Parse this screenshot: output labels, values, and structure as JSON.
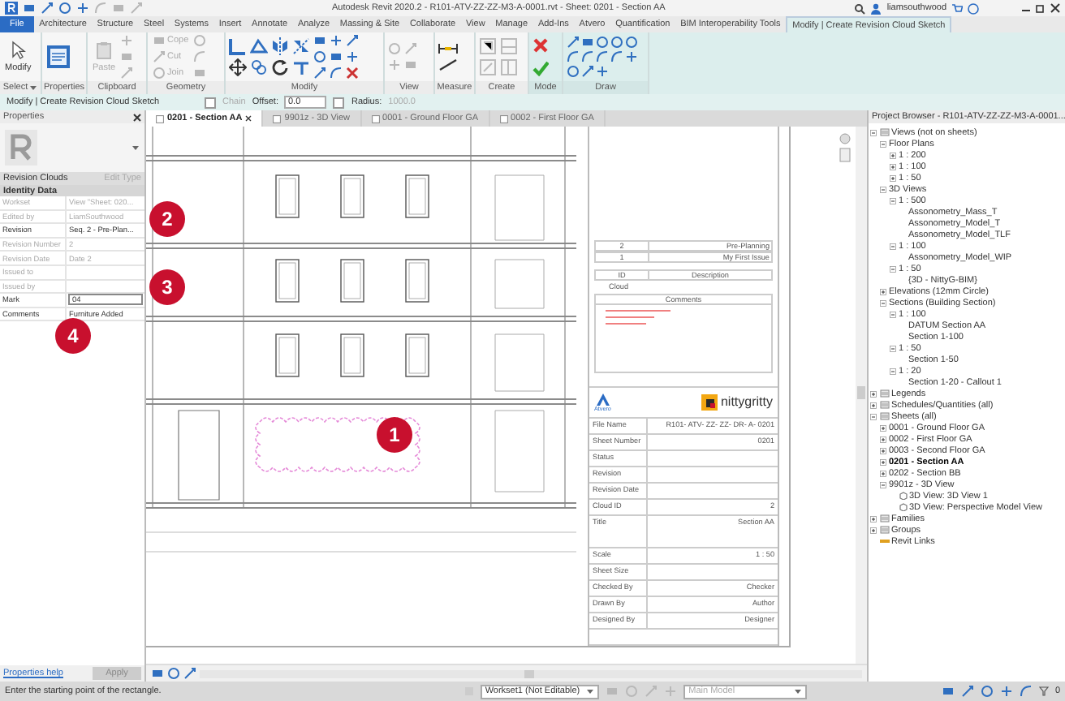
{
  "title_bar": {
    "title": "Autodesk Revit 2020.2 - R101-ATV-ZZ-ZZ-M3-A-0001.rvt - Sheet: 0201 - Section AA",
    "user": "liamsouthwood"
  },
  "ribbon_tabs": [
    {
      "label": "File",
      "kind": "file",
      "selected": false
    },
    {
      "label": "Architecture",
      "kind": "tab",
      "selected": false
    },
    {
      "label": "Structure",
      "kind": "tab",
      "selected": false
    },
    {
      "label": "Steel",
      "kind": "tab",
      "selected": false
    },
    {
      "label": "Systems",
      "kind": "tab",
      "selected": false
    },
    {
      "label": "Insert",
      "kind": "tab",
      "selected": false
    },
    {
      "label": "Annotate",
      "kind": "tab",
      "selected": false
    },
    {
      "label": "Analyze",
      "kind": "tab",
      "selected": false
    },
    {
      "label": "Massing & Site",
      "kind": "tab",
      "selected": false
    },
    {
      "label": "Collaborate",
      "kind": "tab",
      "selected": false
    },
    {
      "label": "View",
      "kind": "tab",
      "selected": false
    },
    {
      "label": "Manage",
      "kind": "tab",
      "selected": false
    },
    {
      "label": "Add-Ins",
      "kind": "tab",
      "selected": false
    },
    {
      "label": "Atvero",
      "kind": "tab",
      "selected": false
    },
    {
      "label": "Quantification",
      "kind": "tab",
      "selected": false
    },
    {
      "label": "BIM Interoperability Tools",
      "kind": "tab",
      "selected": false
    },
    {
      "label": "Modify | Create Revision Cloud Sketch",
      "kind": "contextual",
      "selected": true
    }
  ],
  "ribbon_panels": [
    {
      "label": "Select",
      "dropdown": true,
      "tools": [
        {
          "label": "Modify",
          "disabled": false
        }
      ]
    },
    {
      "label": "Properties",
      "dropdown": false
    },
    {
      "label": "Clipboard",
      "dropdown": false,
      "tools": [
        {
          "label": "Paste",
          "disabled": true
        }
      ]
    },
    {
      "label": "Geometry",
      "dropdown": false,
      "tools": [
        {
          "label": "Cope",
          "disabled": true
        },
        {
          "label": "Cut",
          "disabled": true
        },
        {
          "label": "Join",
          "disabled": true
        }
      ]
    },
    {
      "label": "Modify",
      "dropdown": false
    },
    {
      "label": "View",
      "dropdown": false
    },
    {
      "label": "Measure",
      "dropdown": false
    },
    {
      "label": "Create",
      "dropdown": false
    },
    {
      "label": "Mode",
      "dropdown": false
    },
    {
      "label": "Draw",
      "dropdown": false
    }
  ],
  "options_bar": {
    "context": "Modify | Create Revision Cloud Sketch",
    "chain": {
      "label": "Chain",
      "checked": false,
      "disabled": true
    },
    "offset": {
      "label": "Offset:",
      "value": "0.0"
    },
    "radius": {
      "label": "Radius:",
      "checked": false,
      "value": "1000.0"
    }
  },
  "properties": {
    "title": "Properties",
    "type": "Revision Clouds",
    "edit_type": "Edit Type",
    "group": "Identity Data",
    "rows": [
      {
        "label": "Workset",
        "value": "View \"Sheet: 020...",
        "disabled": true,
        "kind": "text"
      },
      {
        "label": "Edited by",
        "value": "LiamSouthwood",
        "disabled": true,
        "kind": "text"
      },
      {
        "label": "Revision",
        "value": "Seq. 2 - Pre-Plan...",
        "disabled": false,
        "kind": "text"
      },
      {
        "label": "Revision Number",
        "value": "2",
        "disabled": true,
        "kind": "text"
      },
      {
        "label": "Revision Date",
        "value": "Date 2",
        "disabled": true,
        "kind": "text"
      },
      {
        "label": "Issued to",
        "disabled": true,
        "kind": "text"
      },
      {
        "label": "Issued by",
        "disabled": true,
        "kind": "text"
      },
      {
        "label": "Mark",
        "value": "04",
        "disabled": false,
        "kind": "input"
      },
      {
        "label": "Comments",
        "value": "Furniture Added",
        "disabled": false,
        "kind": "text"
      }
    ],
    "help": "Properties help",
    "apply": "Apply"
  },
  "view_tabs": [
    {
      "label": "0201 - Section AA",
      "selected": true
    },
    {
      "label": "9901z - 3D View",
      "selected": false
    },
    {
      "label": "0001 - Ground Floor GA",
      "selected": false
    },
    {
      "label": "0002 - First Floor GA",
      "selected": false
    }
  ],
  "title_block": {
    "revisions": [
      {
        "id": "2",
        "description": "Pre-Planning"
      },
      {
        "id": "1",
        "description": "My First Issue"
      }
    ],
    "revision_header": {
      "id": "ID",
      "description": "Description"
    },
    "cloud_label": "Cloud",
    "comments_label": "Comments",
    "left_logo": "Atvero",
    "right_logo": "nittygritty",
    "fields": [
      {
        "label": "File Name",
        "value": "R101- ATV- ZZ- ZZ- DR- A- 0201",
        "kind": "row"
      },
      {
        "label": "Sheet Number",
        "value": "0201",
        "kind": "row"
      },
      {
        "label": "Status",
        "kind": "row"
      },
      {
        "label": "Revision",
        "kind": "row"
      },
      {
        "label": "Revision Date",
        "kind": "row"
      },
      {
        "label": "Cloud ID",
        "value": "2",
        "kind": "row"
      },
      {
        "label": "Title",
        "value": "Section AA",
        "kind": "tall"
      },
      {
        "label": "Scale",
        "value": "1 : 50",
        "kind": "row"
      },
      {
        "label": "Sheet Size",
        "kind": "row"
      },
      {
        "label": "Checked By",
        "value": "Checker",
        "kind": "row"
      },
      {
        "label": "Drawn By",
        "value": "Author",
        "kind": "row"
      },
      {
        "label": "Designed By",
        "value": "Designer",
        "kind": "row"
      }
    ]
  },
  "callouts": [
    "1",
    "2",
    "3",
    "4"
  ],
  "project_browser": {
    "title": "Project Browser - R101-ATV-ZZ-ZZ-M3-A-0001...",
    "tree": [
      {
        "label": "Views (not on sheets)",
        "kind": "category",
        "expanded": true,
        "children": [
          {
            "label": "Floor Plans",
            "kind": "node",
            "expanded": true,
            "children": [
              {
                "label": "1 : 200",
                "kind": "node",
                "expanded": false
              },
              {
                "label": "1 : 100",
                "kind": "node",
                "expanded": false
              },
              {
                "label": "1 : 50",
                "kind": "node",
                "expanded": false
              }
            ]
          },
          {
            "label": "3D Views",
            "kind": "node",
            "expanded": true,
            "children": [
              {
                "label": "1 : 500",
                "kind": "node",
                "expanded": true,
                "children": [
                  {
                    "label": "Assonometry_Mass_T",
                    "kind": "leaf"
                  },
                  {
                    "label": "Assonometry_Model_T",
                    "kind": "leaf"
                  },
                  {
                    "label": "Assonometry_Model_TLF",
                    "kind": "leaf"
                  }
                ]
              },
              {
                "label": "1 : 100",
                "kind": "node",
                "expanded": true,
                "children": [
                  {
                    "label": "Assonometry_Model_WIP",
                    "kind": "leaf"
                  }
                ]
              },
              {
                "label": "1 : 50",
                "kind": "node",
                "expanded": true,
                "children": [
                  {
                    "label": "{3D - NittyG-BIM}",
                    "kind": "leaf"
                  }
                ]
              }
            ]
          },
          {
            "label": "Elevations (12mm Circle)",
            "kind": "node",
            "expanded": false
          },
          {
            "label": "Sections (Building Section)",
            "kind": "node",
            "expanded": true,
            "children": [
              {
                "label": "1 : 100",
                "kind": "node",
                "expanded": true,
                "children": [
                  {
                    "label": "DATUM Section AA",
                    "kind": "leaf"
                  },
                  {
                    "label": "Section 1-100",
                    "kind": "leaf"
                  }
                ]
              },
              {
                "label": "1 : 50",
                "kind": "node",
                "expanded": true,
                "children": [
                  {
                    "label": "Section 1-50",
                    "kind": "leaf"
                  }
                ]
              },
              {
                "label": "1 : 20",
                "kind": "node",
                "expanded": true,
                "children": [
                  {
                    "label": "Section 1-20 - Callout 1",
                    "kind": "leaf"
                  }
                ]
              }
            ]
          }
        ]
      },
      {
        "label": "Legends",
        "kind": "category",
        "expanded": false
      },
      {
        "label": "Schedules/Quantities (all)",
        "kind": "category",
        "expanded": false
      },
      {
        "label": "Sheets (all)",
        "kind": "category",
        "expanded": true,
        "children": [
          {
            "label": "0001 - Ground Floor GA",
            "kind": "node",
            "expanded": false,
            "selected": false
          },
          {
            "label": "0002 - First Floor GA",
            "kind": "node",
            "expanded": false,
            "selected": false
          },
          {
            "label": "0003 - Second Floor GA",
            "kind": "node",
            "expanded": false,
            "selected": false
          },
          {
            "label": "0201 - Section AA",
            "kind": "node",
            "expanded": false,
            "selected": true
          },
          {
            "label": "0202 - Section BB",
            "kind": "node",
            "expanded": false,
            "selected": false
          },
          {
            "label": "9901z - 3D View",
            "kind": "node",
            "expanded": true,
            "selected": false,
            "children": [
              {
                "label": "3D View: 3D View 1",
                "kind": "view3d"
              },
              {
                "label": "3D View: Perspective Model View",
                "kind": "view3d"
              }
            ]
          }
        ]
      },
      {
        "label": "Families",
        "kind": "category",
        "expanded": false
      },
      {
        "label": "Groups",
        "kind": "category",
        "expanded": false
      },
      {
        "label": "Revit Links",
        "kind": "link"
      }
    ]
  },
  "status_bar": {
    "message": "Enter the starting point of the rectangle.",
    "workset": "Workset1 (Not Editable)",
    "model": "Main Model",
    "filter_count": "0"
  }
}
